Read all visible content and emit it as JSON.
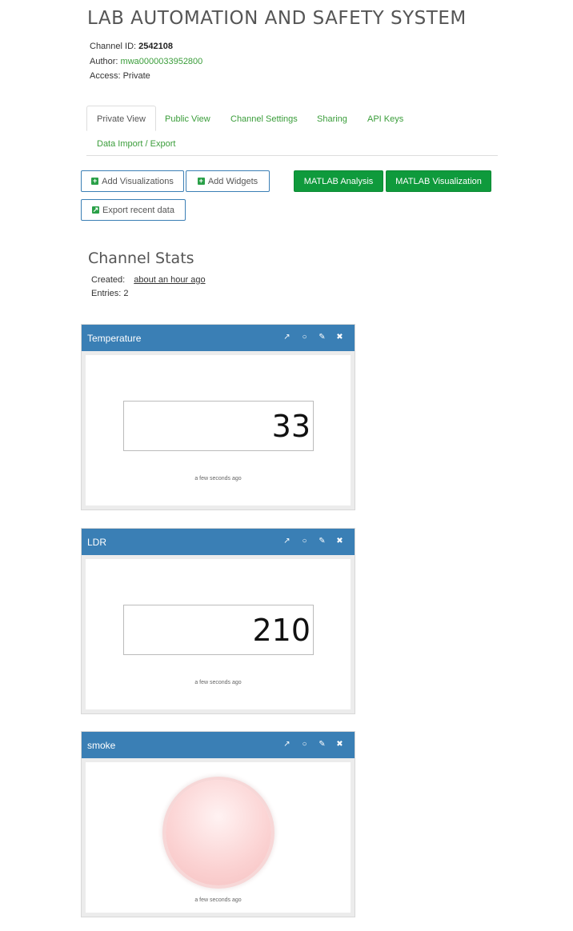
{
  "title": "LAB AUTOMATION AND SAFETY SYSTEM",
  "channel": {
    "id_label": "Channel ID:",
    "id_value": "2542108",
    "author_label": "Author:",
    "author_value": "mwa0000033952800",
    "access": "Access: Private"
  },
  "tabs": [
    "Private View",
    "Public View",
    "Channel Settings",
    "Sharing",
    "API Keys",
    "Data Import / Export"
  ],
  "buttons": {
    "add_visualizations": "Add Visualizations",
    "add_widgets": "Add Widgets",
    "matlab_analysis": "MATLAB Analysis",
    "matlab_visualization": "MATLAB Visualization",
    "export_recent": "Export recent data"
  },
  "stats": {
    "heading": "Channel Stats",
    "created_label": "Created:",
    "created_value": "about an hour ago",
    "entries": "Entries: 2"
  },
  "widgets": [
    {
      "title": "Temperature",
      "value": "33",
      "timestamp": "a few seconds ago"
    },
    {
      "title": "LDR",
      "value": "210",
      "timestamp": "a few seconds ago"
    },
    {
      "title": "smoke",
      "timestamp": "a few seconds ago"
    }
  ],
  "colors": {
    "accent_green": "#0f9a3c",
    "widget_header": "#3a7fb5",
    "lamp": "#fbd2d2"
  },
  "icons": [
    "external-link-icon",
    "comment-icon",
    "pencil-icon",
    "close-icon"
  ]
}
